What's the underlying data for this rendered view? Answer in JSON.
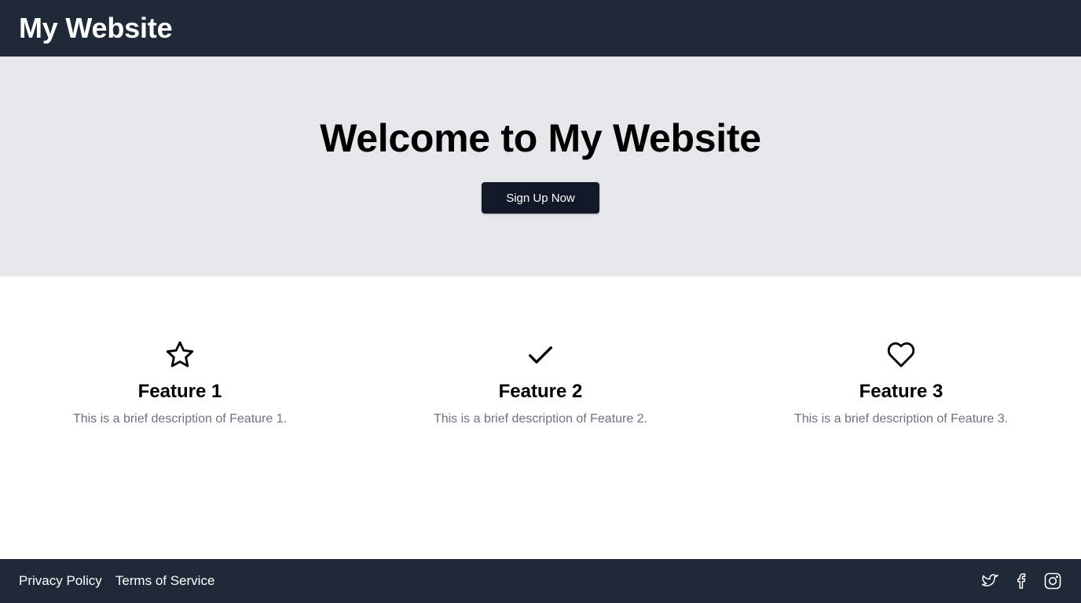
{
  "header": {
    "site_title": "My Website"
  },
  "hero": {
    "title": "Welcome to My Website",
    "cta_label": "Sign Up Now"
  },
  "features": [
    {
      "icon": "star-icon",
      "title": "Feature 1",
      "description": "This is a brief description of Feature 1."
    },
    {
      "icon": "check-icon",
      "title": "Feature 2",
      "description": "This is a brief description of Feature 2."
    },
    {
      "icon": "heart-icon",
      "title": "Feature 3",
      "description": "This is a brief description of Feature 3."
    }
  ],
  "footer": {
    "links": [
      {
        "label": "Privacy Policy"
      },
      {
        "label": "Terms of Service"
      }
    ],
    "social_icons": [
      "twitter-icon",
      "facebook-icon",
      "instagram-icon"
    ]
  },
  "colors": {
    "header_bg": "#1f2937",
    "hero_bg": "#e5e7eb",
    "button_bg": "#111827",
    "description_text": "#6b7280",
    "footer_bg": "#1f2937"
  }
}
